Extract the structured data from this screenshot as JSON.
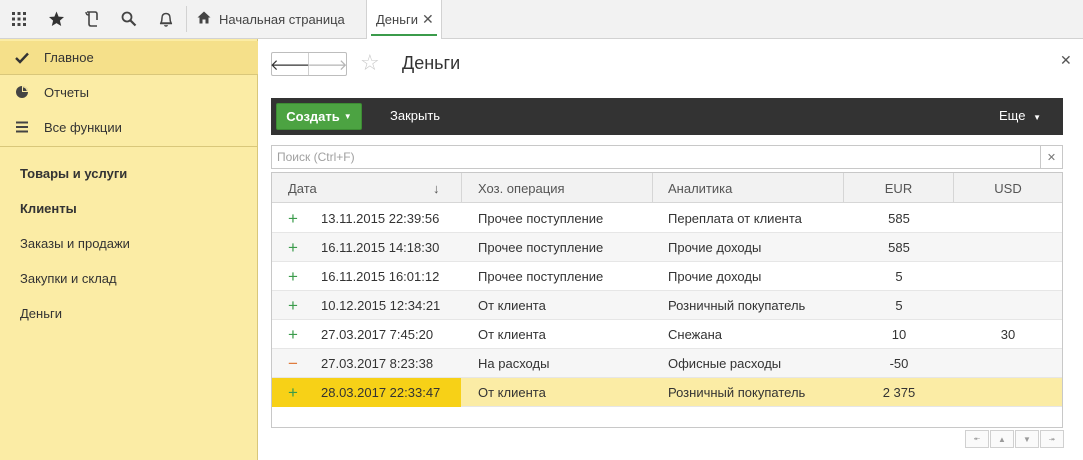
{
  "topbar": {
    "icons": [
      "grid-menu-icon",
      "star-icon",
      "history-icon",
      "search-icon",
      "bell-icon"
    ],
    "home_tab": "Начальная страница",
    "active_tab": "Деньги"
  },
  "sidebar": {
    "nav": [
      {
        "label": "Главное",
        "icon": "check-icon"
      },
      {
        "label": "Отчеты",
        "icon": "pie-chart-icon"
      },
      {
        "label": "Все функции",
        "icon": "list-icon"
      }
    ],
    "sections": [
      {
        "label": "Товары и услуги",
        "bold": true
      },
      {
        "label": "Клиенты",
        "bold": true
      },
      {
        "label": "Заказы и продажи",
        "bold": false
      },
      {
        "label": "Закупки и склад",
        "bold": false
      },
      {
        "label": "Деньги",
        "bold": false
      }
    ]
  },
  "main": {
    "title": "Деньги",
    "create_label": "Создать",
    "close_label": "Закрыть",
    "more_label": "Еще",
    "search_placeholder": "Поиск (Ctrl+F)"
  },
  "table": {
    "columns": [
      "Дата",
      "Хоз. операция",
      "Аналитика",
      "EUR",
      "USD"
    ],
    "sort_indicator": "↓",
    "rows": [
      {
        "sign": "+",
        "date": "13.11.2015 22:39:56",
        "op": "Прочее поступление",
        "analytics": "Переплата от клиента",
        "eur": "585",
        "usd": ""
      },
      {
        "sign": "+",
        "date": "16.11.2015 14:18:30",
        "op": "Прочее поступление",
        "analytics": "Прочие доходы",
        "eur": "585",
        "usd": ""
      },
      {
        "sign": "+",
        "date": "16.11.2015 16:01:12",
        "op": "Прочее поступление",
        "analytics": "Прочие доходы",
        "eur": "5",
        "usd": ""
      },
      {
        "sign": "+",
        "date": "10.12.2015 12:34:21",
        "op": "От клиента",
        "analytics": "Розничный покупатель",
        "eur": "5",
        "usd": ""
      },
      {
        "sign": "+",
        "date": "27.03.2017 7:45:20",
        "op": "От клиента",
        "analytics": "Снежана",
        "eur": "10",
        "usd": "30"
      },
      {
        "sign": "−",
        "date": "27.03.2017 8:23:38",
        "op": "На расходы",
        "analytics": "Офисные расходы",
        "eur": "-50",
        "usd": ""
      },
      {
        "sign": "+",
        "date": "28.03.2017 22:33:47",
        "op": "От клиента",
        "analytics": "Розничный покупатель",
        "eur": "2 375",
        "usd": ""
      }
    ]
  },
  "colors": {
    "sidebar_bg": "#fbeca5",
    "accent_green": "#4ca342",
    "command_bar": "#333333",
    "selected_row": "#fbeca5",
    "selected_cell": "#f7d117"
  }
}
